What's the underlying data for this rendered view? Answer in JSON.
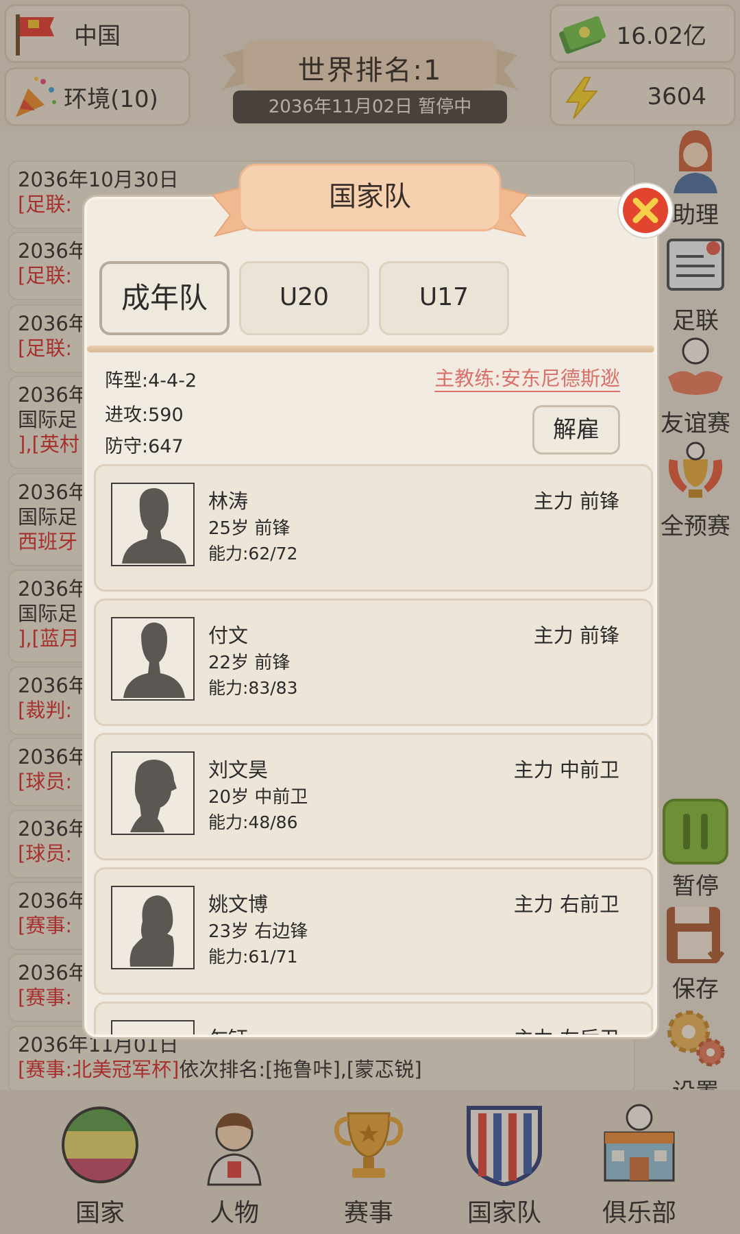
{
  "header": {
    "country": "中国",
    "environment": "环境(10)",
    "world_rank": "世界排名:1",
    "date_status": "2036年11月02日  暂停中",
    "money": "16.02亿",
    "energy": "3604"
  },
  "feed": [
    {
      "date": "2036年10月30日",
      "tag": "[足联:",
      "text": ""
    },
    {
      "date": "2036年",
      "tag": "[足联:",
      "text": ""
    },
    {
      "date": "2036年",
      "tag": "[足联:",
      "text": ""
    },
    {
      "date": "2036年",
      "line2": "国际足",
      "tag": "],[英村",
      "text": ""
    },
    {
      "date": "2036年",
      "line2": "国际足",
      "tag": "西班牙",
      "text": ""
    },
    {
      "date": "2036年",
      "line2": "国际足",
      "tag": "],[蓝月",
      "text": ""
    },
    {
      "date": "2036年",
      "tag": "[裁判:",
      "text": ""
    },
    {
      "date": "2036年",
      "tag": "[球员:",
      "text": ""
    },
    {
      "date": "2036年",
      "tag": "[球员:",
      "text": ""
    },
    {
      "date": "2036年",
      "tag": "[赛事:",
      "text": ""
    },
    {
      "date": "2036年",
      "tag": "[赛事:",
      "text": ""
    },
    {
      "date": "2036年11月01日",
      "tag": "[赛事:北美冠军杯]",
      "text": "依次排名:[拖鲁咔],[蒙忑锐]"
    }
  ],
  "side_buttons": {
    "assistant": "助理",
    "federation": "足联",
    "friendly": "友谊赛",
    "qualifier": "全预赛",
    "pause": "暂停",
    "save": "保存",
    "settings": "设置"
  },
  "bottom_nav": {
    "country": "国家",
    "people": "人物",
    "events": "赛事",
    "national_team": "国家队",
    "club": "俱乐部"
  },
  "modal": {
    "title": "国家队",
    "tabs": [
      "成年队",
      "U20",
      "U17"
    ],
    "formation": "阵型:4-4-2",
    "coach": "主教练:安东尼德斯逖",
    "attack": "进攻:590",
    "defense": "防守:647",
    "fire_label": "解雇",
    "players": [
      {
        "name": "林涛",
        "age_pos": "25岁  前锋",
        "ability": "能力:62/72",
        "status": "主力  前锋"
      },
      {
        "name": "付文",
        "age_pos": "22岁  前锋",
        "ability": "能力:83/83",
        "status": "主力  前锋"
      },
      {
        "name": "刘文昊",
        "age_pos": "20岁  中前卫",
        "ability": "能力:48/86",
        "status": "主力  中前卫"
      },
      {
        "name": "姚文博",
        "age_pos": "23岁  右边锋",
        "ability": "能力:61/71",
        "status": "主力  右前卫"
      },
      {
        "name": "乍钰",
        "age_pos": "",
        "ability": "",
        "status": "主力  左后卫"
      }
    ]
  },
  "colors": {
    "accent_red": "#d22b2b",
    "coach_pink": "#d9706a",
    "panel_bg": "#f1ebe1"
  }
}
